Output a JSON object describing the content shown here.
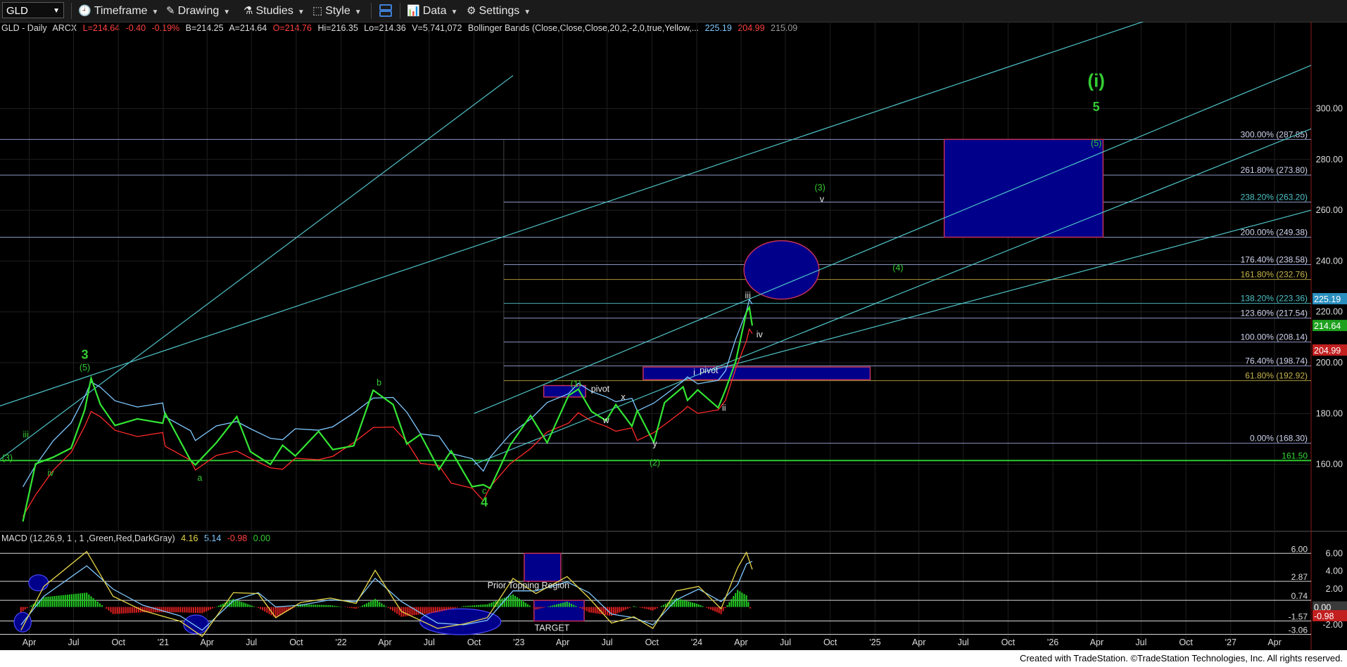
{
  "toolbar": {
    "symbol": "GLD",
    "items": [
      "Timeframe",
      "Drawing",
      "Studies",
      "Style",
      "Data",
      "Settings"
    ]
  },
  "price_legend": {
    "name": "GLD - Daily",
    "exchange": "ARCX",
    "last": "L=214.64",
    "change": "-0.40",
    "pct": "-0.19%",
    "bid": "B=214.25",
    "ask": "A=214.64",
    "open": "O=214.76",
    "hi": "Hi=216.35",
    "lo": "Lo=214.36",
    "vol": "V=5,741,072",
    "study": "Bollinger Bands (Close,Close,Close,20,2,-2,0,true,Yellow,...",
    "bb_upper": "225.19",
    "bb_lower": "204.99",
    "bb_mid": "215.09"
  },
  "macd_legend": {
    "name": "MACD (12,26,9, 1 , 1 ,Green,Red,DarkGray)",
    "v1": "4.16",
    "v2": "5.14",
    "v3": "-0.98",
    "v4": "0.00"
  },
  "footer": "Created with TradeStation. ©TradeStation Technologies, Inc. All rights reserved.",
  "colors": {
    "price": "#33e633",
    "bb_upper": "#7fc8ff",
    "bb_lower": "#ff2a2a",
    "channel": "#4fc3c8",
    "fib": "#9aa6d6",
    "box": "#00008b",
    "box_border": "#c0305a",
    "green_label": "#33cc33",
    "axis_bg": "#000"
  },
  "chart_data": {
    "type": "line",
    "title": "GLD - Daily",
    "x_ticks": [
      "Apr",
      "Jul",
      "Oct",
      "'21",
      "Apr",
      "Jul",
      "Oct",
      "'22",
      "Apr",
      "Jul",
      "Oct",
      "'23",
      "Apr",
      "Jul",
      "Oct",
      "'24",
      "Apr",
      "Jul",
      "Oct",
      "'25",
      "Apr",
      "Jul",
      "Oct",
      "'26",
      "Apr",
      "Jul",
      "Oct",
      "'27",
      "Apr"
    ],
    "y_ticks": [
      160,
      180,
      200,
      220,
      240,
      260,
      280,
      300
    ],
    "ylim": [
      140,
      313
    ],
    "xlim": [
      "2020-02-01",
      "2027-06-15"
    ],
    "price_series": {
      "name": "GLD",
      "dates": [
        "2020-03-19",
        "2020-04-14",
        "2020-05-20",
        "2020-06-26",
        "2020-07-24",
        "2020-08-06",
        "2020-08-25",
        "2020-09-24",
        "2020-11-09",
        "2020-12-31",
        "2021-01-05",
        "2021-02-26",
        "2021-03-08",
        "2021-04-20",
        "2021-06-01",
        "2021-06-29",
        "2021-08-09",
        "2021-09-03",
        "2021-09-29",
        "2021-11-16",
        "2021-12-15",
        "2022-01-27",
        "2022-03-08",
        "2022-04-18",
        "2022-05-16",
        "2022-06-13",
        "2022-07-21",
        "2022-08-15",
        "2022-09-27",
        "2022-10-20",
        "2022-11-03",
        "2022-12-14",
        "2023-01-25",
        "2023-02-28",
        "2023-04-13",
        "2023-05-03",
        "2023-05-30",
        "2023-06-29",
        "2023-07-19",
        "2023-08-21",
        "2023-09-01",
        "2023-10-05",
        "2023-10-27",
        "2023-12-04",
        "2023-12-13",
        "2024-01-03",
        "2024-02-14",
        "2024-02-29",
        "2024-03-21",
        "2024-04-12",
        "2024-04-18",
        "2024-04-24"
      ],
      "values": [
        137.5,
        160.2,
        162.8,
        166.4,
        181.5,
        193.9,
        183.6,
        175.3,
        177.9,
        176.2,
        180.1,
        161.6,
        159.8,
        168.5,
        178.8,
        165.0,
        160.0,
        167.5,
        163.3,
        173.0,
        165.8,
        167.3,
        189.2,
        183.5,
        168.0,
        171.8,
        158.0,
        165.3,
        151.2,
        152.0,
        150.6,
        167.5,
        179.2,
        168.5,
        187.1,
        189.6,
        180.8,
        177.2,
        183.5,
        175.0,
        181.2,
        168.6,
        184.3,
        190.5,
        185.2,
        189.3,
        182.3,
        189.3,
        200.5,
        219.9,
        221.8,
        214.6
      ]
    },
    "horizontal_levels": [
      {
        "label": "300.00% (287.85)",
        "value": 287.85
      },
      {
        "label": "261.80% (273.80)",
        "value": 273.8
      },
      {
        "label": "238.20% (263.20)",
        "value": 263.2
      },
      {
        "label": "200.00% (249.38)",
        "value": 249.38
      },
      {
        "label": "176.40% (238.58)",
        "value": 238.58
      },
      {
        "label": "161.80% (232.76)",
        "value": 232.76
      },
      {
        "label": "138.20% (223.36)",
        "value": 223.36
      },
      {
        "label": "123.60% (217.54)",
        "value": 217.54
      },
      {
        "label": "100.00% (208.14)",
        "value": 208.14
      },
      {
        "label": "76.40% (198.74)",
        "value": 198.74
      },
      {
        "label": "61.80% (192.92)",
        "value": 192.92
      },
      {
        "label": "0.00% (168.30)",
        "value": 168.3
      },
      {
        "label": "161.50",
        "value": 161.5
      }
    ],
    "price_tags": [
      {
        "value": 225.19,
        "label": "225.19",
        "color": "#2a8fbf"
      },
      {
        "value": 214.64,
        "label": "214.64",
        "color": "#1fa11f"
      },
      {
        "value": 204.99,
        "label": "204.99",
        "color": "#c21f1f"
      }
    ],
    "wave_labels": [
      {
        "date": "2020-07-24",
        "value": 201.5,
        "text": "3",
        "big": true
      },
      {
        "date": "2020-07-24",
        "value": 197.0,
        "text": "(5)"
      },
      {
        "date": "2020-03-25",
        "value": 170.5,
        "text": "iii"
      },
      {
        "date": "2020-05-15",
        "value": 155.5,
        "text": "iv"
      },
      {
        "date": "2020-02-16",
        "value": 161.5,
        "text": "(3)"
      },
      {
        "date": "2021-03-17",
        "value": 153.5,
        "text": "a"
      },
      {
        "date": "2022-03-20",
        "value": 191.0,
        "text": "b"
      },
      {
        "date": "2022-10-22",
        "value": 148.5,
        "text": "c"
      },
      {
        "date": "2022-10-22",
        "value": 143.5,
        "text": "4",
        "big": true
      },
      {
        "date": "2023-04-28",
        "value": 190.5,
        "text": "(1)"
      },
      {
        "date": "2023-08-03",
        "value": 185.3,
        "text": "x"
      },
      {
        "date": "2023-06-29",
        "value": 176.2,
        "text": "w"
      },
      {
        "date": "2023-10-07",
        "value": 167.0,
        "text": "y"
      },
      {
        "date": "2023-10-07",
        "value": 159.5,
        "text": "(2)"
      },
      {
        "date": "2023-12-27",
        "value": 195.0,
        "text": "i"
      },
      {
        "date": "2024-02-26",
        "value": 181.0,
        "text": "ii"
      },
      {
        "date": "2024-04-15",
        "value": 225.3,
        "text": "iii"
      },
      {
        "date": "2024-05-09",
        "value": 210.0,
        "text": "iv"
      },
      {
        "date": "2024-09-10",
        "value": 267.8,
        "text": "(3)"
      },
      {
        "date": "2024-09-14",
        "value": 263.2,
        "text": "v"
      },
      {
        "date": "2025-02-17",
        "value": 236.2,
        "text": "(4)"
      },
      {
        "date": "2026-03-31",
        "value": 308.5,
        "text": "(i)",
        "huge": true
      },
      {
        "date": "2026-03-31",
        "value": 299.0,
        "text": "5",
        "big": true
      },
      {
        "date": "2026-03-31",
        "value": 285.2,
        "text": "(5)"
      }
    ],
    "text_labels": [
      {
        "date": "2023-06-17",
        "value": 188.5,
        "text": "pivot"
      },
      {
        "date": "2024-01-26",
        "value": 195.8,
        "text": "pivot"
      }
    ],
    "boxes": [
      {
        "from": "2025-05-23",
        "to": "2026-04-14",
        "top": 287.85,
        "bottom": 249.38
      },
      {
        "from": "2023-09-13",
        "to": "2024-12-22",
        "top": 198.3,
        "bottom": 193.3
      },
      {
        "from": "2023-02-21",
        "to": "2023-05-18",
        "top": 191.0,
        "bottom": 186.5
      }
    ],
    "ellipses": [
      {
        "from": "2024-04-07",
        "to": "2024-09-08",
        "top": 248.0,
        "bottom": 225.0
      }
    ],
    "macd": {
      "name": "MACD",
      "ylim": [
        -4.2,
        7.2
      ],
      "y_ticks": [
        -2,
        0,
        2,
        4,
        6
      ],
      "levels": [
        {
          "value": 6.0,
          "label": "6.00"
        },
        {
          "value": 2.87,
          "label": "2.87"
        },
        {
          "value": 0.74,
          "label": "0.74"
        },
        {
          "value": -1.57,
          "label": "-1.57"
        },
        {
          "value": -3.06,
          "label": "-3.06"
        }
      ],
      "tags": [
        {
          "value": 0.0,
          "label": "0.00",
          "color": "#3a3a3a"
        },
        {
          "value": -0.98,
          "label": "-0.98",
          "color": "#c21f1f"
        }
      ],
      "dates": [
        "2020-03-15",
        "2020-05-01",
        "2020-07-28",
        "2020-09-20",
        "2020-11-20",
        "2021-02-05",
        "2021-03-22",
        "2021-05-25",
        "2021-07-15",
        "2021-08-20",
        "2021-10-10",
        "2021-12-10",
        "2022-02-01",
        "2022-03-12",
        "2022-05-05",
        "2022-07-18",
        "2022-09-10",
        "2022-10-28",
        "2022-12-20",
        "2023-02-05",
        "2023-04-10",
        "2023-05-25",
        "2023-07-10",
        "2023-08-25",
        "2023-10-03",
        "2023-11-20",
        "2024-01-05",
        "2024-02-20",
        "2024-03-25",
        "2024-04-12",
        "2024-04-24"
      ],
      "line": [
        -2.6,
        2.3,
        6.2,
        1.2,
        -0.4,
        -1.6,
        -3.3,
        1.6,
        1.5,
        -1.2,
        0.5,
        1.0,
        0.4,
        4.1,
        -0.5,
        -2.4,
        -1.9,
        -1.2,
        3.2,
        1.5,
        3.4,
        1.0,
        -1.8,
        -1.1,
        -2.4,
        1.8,
        2.3,
        -0.2,
        4.4,
        6.1,
        4.2
      ],
      "signal": [
        -2.0,
        1.2,
        4.6,
        2.0,
        0.2,
        -1.0,
        -2.6,
        0.7,
        1.6,
        0.0,
        0.2,
        0.8,
        0.6,
        3.2,
        0.6,
        -1.8,
        -2.0,
        -1.5,
        1.8,
        1.8,
        2.8,
        1.6,
        -0.8,
        -1.2,
        -2.0,
        0.8,
        2.0,
        0.6,
        2.5,
        4.8,
        5.1
      ],
      "boxes": [
        {
          "from": "2023-01-12",
          "to": "2023-03-28",
          "top": 6.0,
          "bottom": 2.87,
          "label": "Prior Topping Region"
        },
        {
          "from": "2023-02-01",
          "to": "2023-05-15",
          "top": 0.74,
          "bottom": -1.57,
          "label": "TARGET"
        }
      ],
      "ellipses": [
        {
          "from": "2020-03-01",
          "to": "2020-04-05",
          "top": -0.6,
          "bottom": -2.8
        },
        {
          "from": "2021-02-12",
          "to": "2021-04-04",
          "top": -0.9,
          "bottom": -3.0
        },
        {
          "from": "2022-06-12",
          "to": "2022-11-25",
          "top": -0.2,
          "bottom": -3.1
        },
        {
          "from": "2020-03-31",
          "to": "2020-05-10",
          "top": 3.6,
          "bottom": 1.8
        }
      ]
    }
  }
}
